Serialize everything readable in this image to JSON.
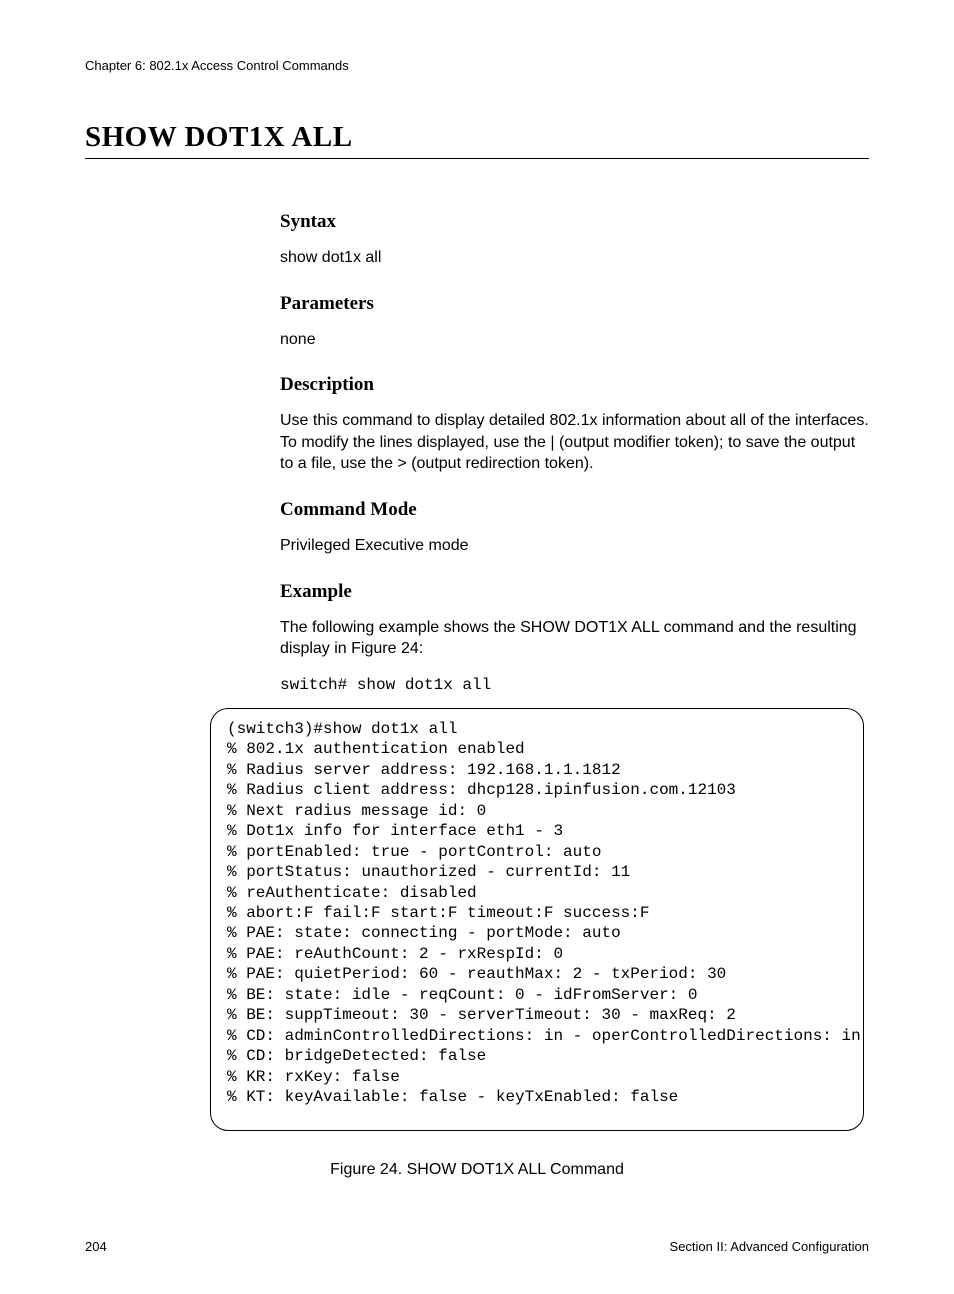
{
  "header": {
    "chapter": "Chapter 6: 802.1x Access Control Commands"
  },
  "title": "SHOW DOT1X ALL",
  "sections": {
    "syntax": {
      "heading": "Syntax",
      "body": "show dot1x all"
    },
    "parameters": {
      "heading": "Parameters",
      "body": "none"
    },
    "description": {
      "heading": "Description",
      "body": "Use this command to display detailed 802.1x information about all of the interfaces. To modify the lines displayed, use the | (output modifier token); to save the output to a file, use the > (output redirection token)."
    },
    "command_mode": {
      "heading": "Command Mode",
      "body": "Privileged Executive mode"
    },
    "example": {
      "heading": "Example",
      "intro": "The following example shows the SHOW DOT1X ALL command and the resulting display in Figure 24:",
      "command": "switch# show dot1x all"
    }
  },
  "terminal_output": "(switch3)#show dot1x all\n% 802.1x authentication enabled\n% Radius server address: 192.168.1.1.1812\n% Radius client address: dhcp128.ipinfusion.com.12103\n% Next radius message id: 0\n% Dot1x info for interface eth1 - 3\n% portEnabled: true - portControl: auto\n% portStatus: unauthorized - currentId: 11\n% reAuthenticate: disabled\n% abort:F fail:F start:F timeout:F success:F\n% PAE: state: connecting - portMode: auto\n% PAE: reAuthCount: 2 - rxRespId: 0\n% PAE: quietPeriod: 60 - reauthMax: 2 - txPeriod: 30\n% BE: state: idle - reqCount: 0 - idFromServer: 0\n% BE: suppTimeout: 30 - serverTimeout: 30 - maxReq: 2\n% CD: adminControlledDirections: in - operControlledDirections: in\n% CD: bridgeDetected: false\n% KR: rxKey: false\n% KT: keyAvailable: false - keyTxEnabled: false",
  "figure_caption": "Figure 24. SHOW DOT1X ALL Command",
  "footer": {
    "page_number": "204",
    "section": "Section II: Advanced Configuration"
  }
}
